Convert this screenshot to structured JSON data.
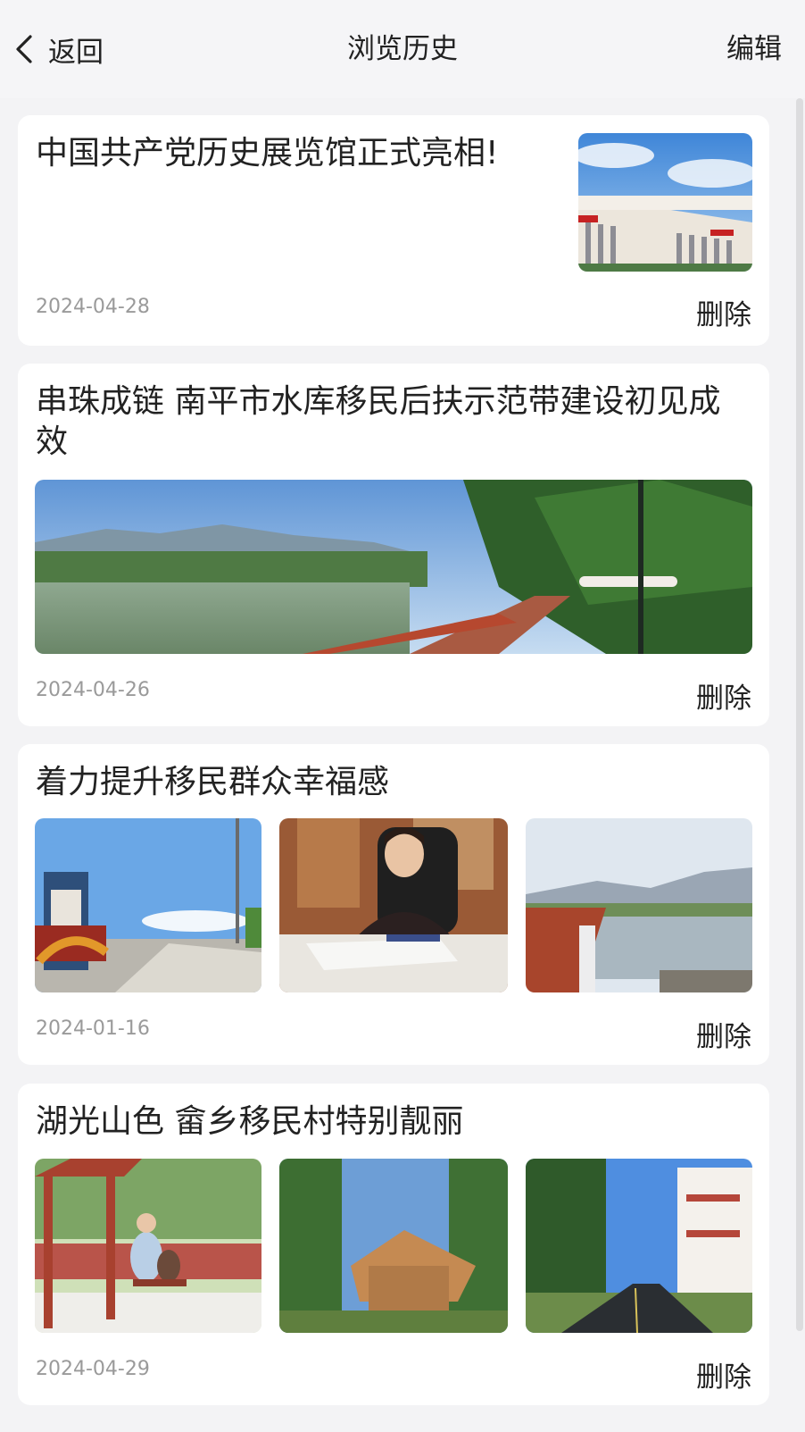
{
  "nav": {
    "back_label": "返回",
    "title": "浏览历史",
    "edit_label": "编辑"
  },
  "items": [
    {
      "title": "中国共产党历史展览馆正式亮相!",
      "date": "2024-04-28",
      "delete_label": "删除",
      "images": [
        "museum-building-photo"
      ]
    },
    {
      "title": "串珠成链 南平市水库移民后扶示范带建设初见成效",
      "date": "2024-04-26",
      "delete_label": "删除",
      "images": [
        "river-walkway-panorama-photo"
      ]
    },
    {
      "title": "着力提升移民群众幸福感",
      "date": "2024-01-16",
      "delete_label": "删除",
      "images": [
        "village-gate-road-photo",
        "woman-reading-documents-photo",
        "lakeside-railing-photo"
      ]
    },
    {
      "title": "湖光山色 畲乡移民村特别靓丽",
      "date": "2024-04-29",
      "delete_label": "删除",
      "images": [
        "swing-mother-child-photo",
        "wooden-pavilion-photo",
        "village-street-photo"
      ]
    }
  ]
}
